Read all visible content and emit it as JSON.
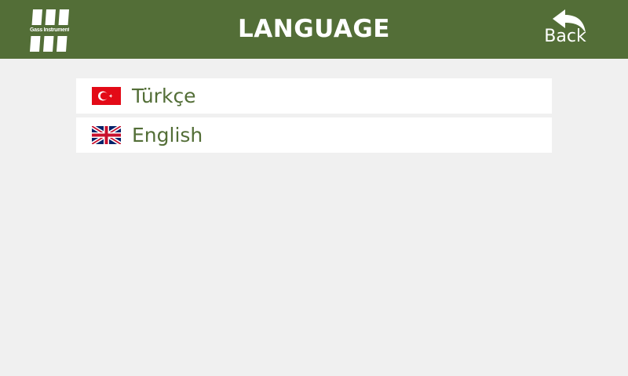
{
  "header": {
    "logo_text": "Gass Instruments",
    "title": "LANGUAGE",
    "back_label": "Back",
    "background_color": "#536e37"
  },
  "languages": [
    {
      "label": "Türkçe",
      "flag_icon": "turkey-flag-icon"
    },
    {
      "label": "English",
      "flag_icon": "uk-flag-icon"
    }
  ],
  "colors": {
    "accent": "#536e37",
    "page_background": "#f0f0f0",
    "item_background": "#ffffff"
  }
}
